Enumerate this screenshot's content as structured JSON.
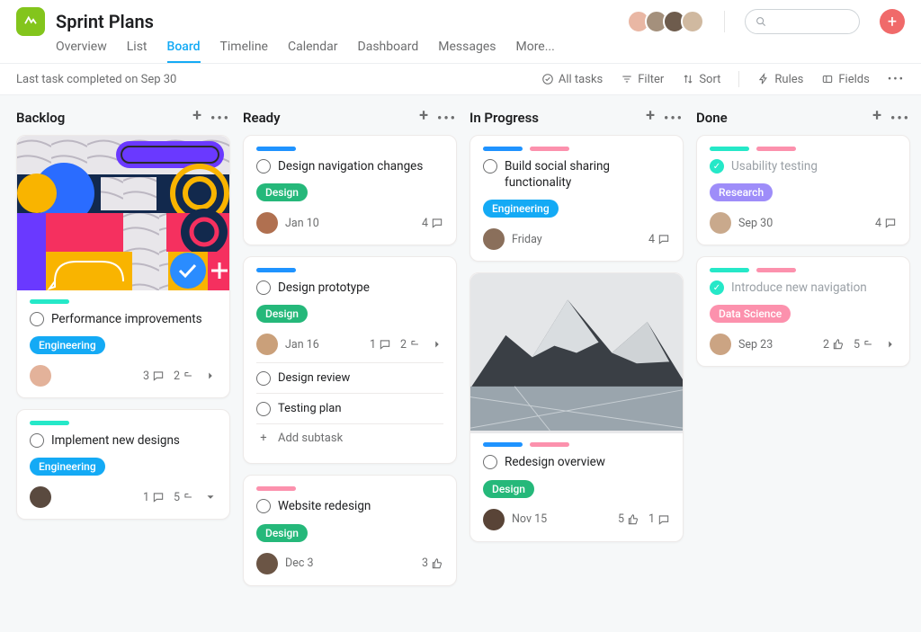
{
  "project": {
    "title": "Sprint Plans"
  },
  "tabs": [
    "Overview",
    "List",
    "Board",
    "Timeline",
    "Calendar",
    "Dashboard",
    "Messages",
    "More..."
  ],
  "activeTab": "Board",
  "toolbar": {
    "status": "Last task completed on Sep 30",
    "allTasks": "All tasks",
    "filter": "Filter",
    "sort": "Sort",
    "rules": "Rules",
    "fields": "Fields"
  },
  "columns": [
    {
      "name": "Backlog",
      "cards": [
        {
          "cover": "art",
          "bars": [
            "teal"
          ],
          "title": "Performance improvements",
          "done": false,
          "tags": [
            {
              "label": "Engineering",
              "cls": "engineering"
            }
          ],
          "assigneeColor": "#e3b29a",
          "date": "",
          "stats": {
            "comments": 3,
            "subtasks": 2,
            "arrow": "right"
          }
        },
        {
          "bars": [
            "teal"
          ],
          "title": "Implement new designs",
          "done": false,
          "tags": [
            {
              "label": "Engineering",
              "cls": "engineering"
            }
          ],
          "assigneeColor": "#5a4a3f",
          "date": "",
          "stats": {
            "comments": 1,
            "subtasks": 5,
            "arrow": "down"
          }
        }
      ]
    },
    {
      "name": "Ready",
      "cards": [
        {
          "bars": [
            "blue"
          ],
          "title": "Design navigation changes",
          "done": false,
          "tags": [
            {
              "label": "Design",
              "cls": "design"
            }
          ],
          "assigneeColor": "#b07050",
          "date": "Jan 10",
          "stats": {
            "comments": 4
          }
        },
        {
          "bars": [
            "blue"
          ],
          "title": "Design prototype",
          "done": false,
          "tags": [
            {
              "label": "Design",
              "cls": "design"
            }
          ],
          "assigneeColor": "#caa07a",
          "date": "Jan 16",
          "stats": {
            "comments": 1,
            "subtasks": 2,
            "arrow": "right"
          },
          "subtasks": [
            "Design review",
            "Testing plan"
          ],
          "addSubtask": "Add subtask"
        },
        {
          "bars": [
            "pink"
          ],
          "title": "Website redesign",
          "done": false,
          "tags": [
            {
              "label": "Design",
              "cls": "design"
            }
          ],
          "assigneeColor": "#6b5545",
          "date": "Dec 3",
          "stats": {
            "likes": 3
          }
        }
      ]
    },
    {
      "name": "In Progress",
      "cards": [
        {
          "bars": [
            "blue",
            "pink"
          ],
          "title": "Build social sharing functionality",
          "done": false,
          "tags": [
            {
              "label": "Engineering",
              "cls": "engineering"
            }
          ],
          "assigneeColor": "#8a6f5b",
          "date": "Friday",
          "stats": {
            "comments": 4
          }
        },
        {
          "cover": "mountain",
          "bars": [
            "blue",
            "pink"
          ],
          "title": "Redesign overview",
          "done": false,
          "tags": [
            {
              "label": "Design",
              "cls": "design"
            }
          ],
          "assigneeColor": "#594437",
          "date": "Nov 15",
          "stats": {
            "likes": 5,
            "comments": 1
          }
        }
      ]
    },
    {
      "name": "Done",
      "cards": [
        {
          "bars": [
            "teal",
            "pink"
          ],
          "title": "Usability testing",
          "done": true,
          "tags": [
            {
              "label": "Research",
              "cls": "research"
            }
          ],
          "assigneeColor": "#c9a98c",
          "date": "Sep 30",
          "stats": {
            "comments": 4
          }
        },
        {
          "bars": [
            "teal",
            "pink"
          ],
          "title": "Introduce new navigation",
          "done": true,
          "tags": [
            {
              "label": "Data Science",
              "cls": "datasci"
            }
          ],
          "assigneeColor": "#cba483",
          "date": "Sep 23",
          "stats": {
            "likes": 2,
            "subtasks": 5,
            "arrow": "right"
          }
        }
      ]
    }
  ]
}
